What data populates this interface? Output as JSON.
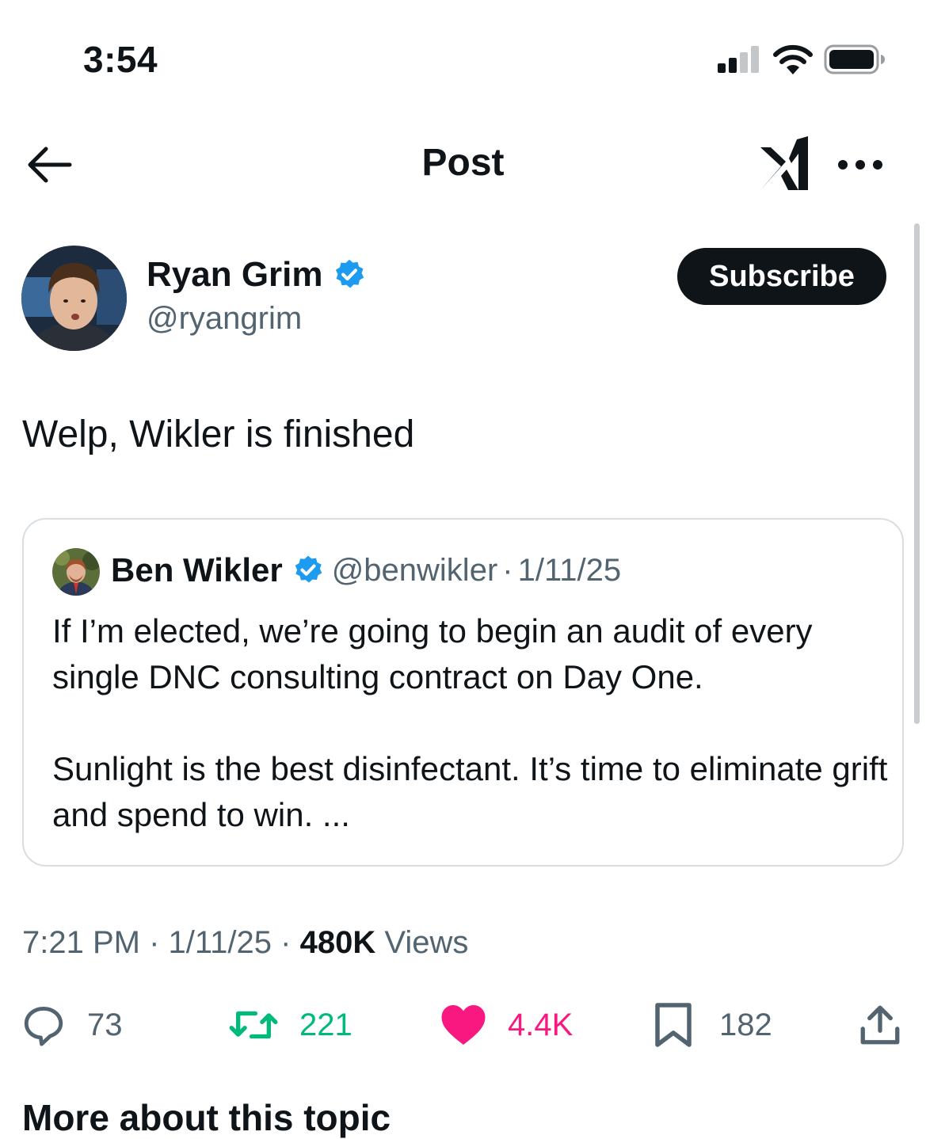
{
  "status_bar": {
    "time": "3:54",
    "icons": [
      "cellular-signal-icon",
      "wifi-icon",
      "battery-icon"
    ]
  },
  "header": {
    "title": "Post",
    "back_icon": "arrow-left-icon",
    "grok_icon": "grok-logo-icon",
    "more_icon": "more-horizontal-icon"
  },
  "author": {
    "name": "Ryan Grim",
    "handle": "@ryangrim",
    "verified": true,
    "subscribe_label": "Subscribe"
  },
  "post": {
    "text": "Welp, Wikler is finished"
  },
  "quote": {
    "name": "Ben Wikler",
    "verified": true,
    "handle": "@benwikler",
    "separator": "·",
    "date": "1/11/25",
    "paragraphs": [
      "If I’m elected, we’re going to begin an audit of every single DNC consulting contract on Day One.",
      "Sunlight is the best disinfectant. It’s time to eliminate grift and spend to win. ..."
    ]
  },
  "meta": {
    "time": "7:21 PM",
    "separator": "·",
    "date": "1/11/25",
    "views_count": "480K",
    "views_label": "Views"
  },
  "actions": {
    "replies": "73",
    "reposts": "221",
    "likes": "4.4K",
    "bookmarks": "182"
  },
  "next_section_title": "More about this topic",
  "colors": {
    "text": "#0f1419",
    "secondary": "#536471",
    "verified": "#1d9bf0",
    "repost": "#00ba7c",
    "like": "#f91880",
    "border": "#d9dee2"
  }
}
